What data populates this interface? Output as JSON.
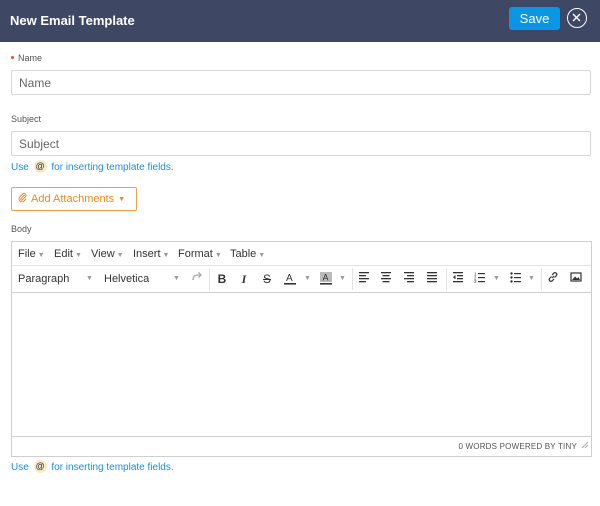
{
  "header": {
    "title": "New Email Template",
    "save_label": "Save"
  },
  "form": {
    "name_label": "Name",
    "name_placeholder": "Name",
    "subject_label": "Subject",
    "subject_placeholder": "Subject",
    "hint_use": "Use",
    "hint_at": "@",
    "hint_rest": "for inserting template fields.",
    "attach_label": "Add Attachments",
    "body_label": "Body"
  },
  "editor": {
    "menus": [
      "File",
      "Edit",
      "View",
      "Insert",
      "Format",
      "Table"
    ],
    "block_format": "Paragraph",
    "font_family": "Helvetica",
    "status": "0 WORDS POWERED BY TINY"
  },
  "colors": {
    "header_bg": "#3e4763",
    "save_bg": "#0b96e5",
    "link": "#1d8ed1",
    "attach": "#f0a040",
    "required": "#e74c3c"
  }
}
